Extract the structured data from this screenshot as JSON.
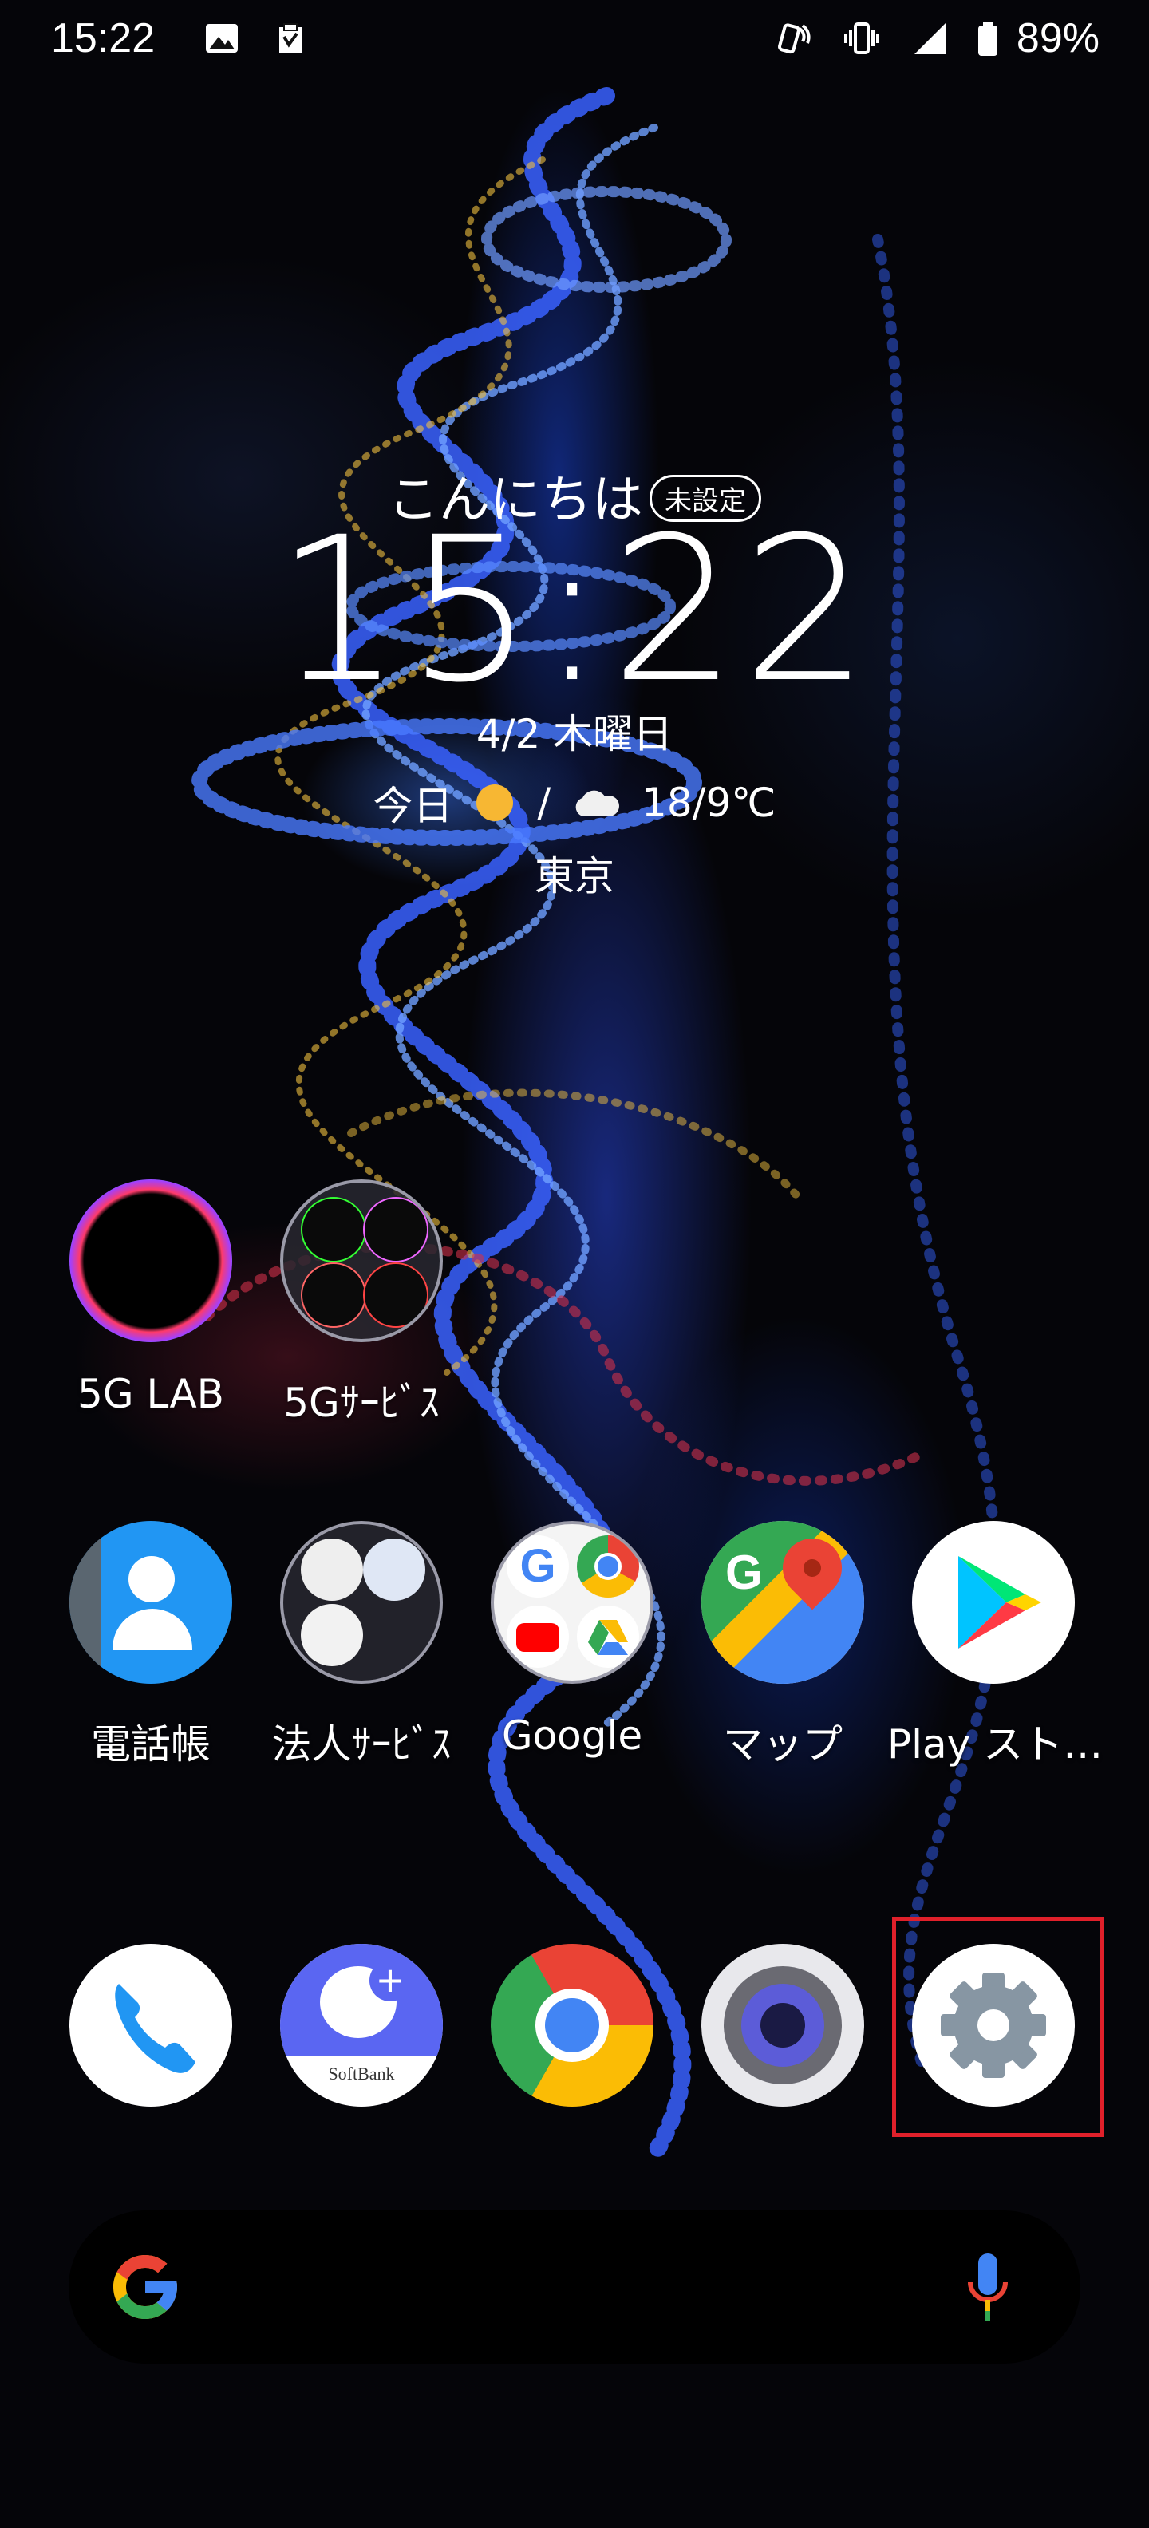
{
  "status_bar": {
    "time": "15:22",
    "battery_percent": "89%",
    "icons": [
      "image-icon",
      "clipboard-icon",
      "nfc-icon",
      "vibrate-icon",
      "signal-icon",
      "battery-icon"
    ]
  },
  "clock_widget": {
    "greeting": "こんにちは",
    "greeting_badge": "未設定",
    "time": "15:22",
    "date": "4/2 木曜日",
    "weather_prefix": "今日",
    "weather_separator": "/",
    "temperature": "18/9℃",
    "location": "東京"
  },
  "row1": [
    {
      "label": "5G LAB",
      "icon": "5g-lab-ring-icon"
    },
    {
      "label": "5Gｻｰﾋﾞｽ",
      "icon": "5g-services-folder-icon"
    }
  ],
  "row2": [
    {
      "label": "電話帳",
      "icon": "contacts-icon"
    },
    {
      "label": "法人ｻｰﾋﾞｽ",
      "icon": "business-services-folder-icon"
    },
    {
      "label": "Google",
      "icon": "google-folder-icon"
    },
    {
      "label": "マップ",
      "icon": "maps-icon"
    },
    {
      "label": "Play スト…",
      "icon": "play-store-icon"
    }
  ],
  "dock": [
    {
      "icon": "phone-icon"
    },
    {
      "icon": "softbank-message-plus-icon",
      "caption": "SoftBank"
    },
    {
      "icon": "chrome-icon"
    },
    {
      "icon": "camera-icon"
    },
    {
      "icon": "settings-gear-icon"
    }
  ],
  "search_bar": {
    "icons": [
      "google-g-icon",
      "microphone-icon"
    ]
  },
  "colors": {
    "highlight": "#e0202a",
    "google_blue": "#4285F4",
    "google_red": "#EA4335",
    "google_yellow": "#FBBC05",
    "google_green": "#34A853"
  }
}
